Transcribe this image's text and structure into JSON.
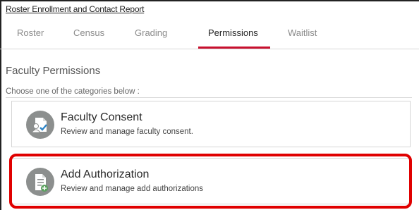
{
  "header": {
    "report_link": "Roster Enrollment and Contact Report"
  },
  "tabs": [
    {
      "label": "Roster",
      "active": false
    },
    {
      "label": "Census",
      "active": false
    },
    {
      "label": "Grading",
      "active": false
    },
    {
      "label": "Permissions",
      "active": true
    },
    {
      "label": "Waitlist",
      "active": false
    }
  ],
  "section": {
    "title": "Faculty Permissions",
    "hint": "Choose one of the categories below :"
  },
  "cards": [
    {
      "title": "Faculty Consent",
      "subtitle": "Review and manage faculty consent.",
      "icon": "faculty-consent-icon"
    },
    {
      "title": "Add Authorization",
      "subtitle": "Review and manage add authorizations",
      "icon": "add-authorization-icon"
    }
  ],
  "colors": {
    "accent": "#c8102e",
    "highlight": "#e00000",
    "icon_bg": "#8c8f8e"
  }
}
